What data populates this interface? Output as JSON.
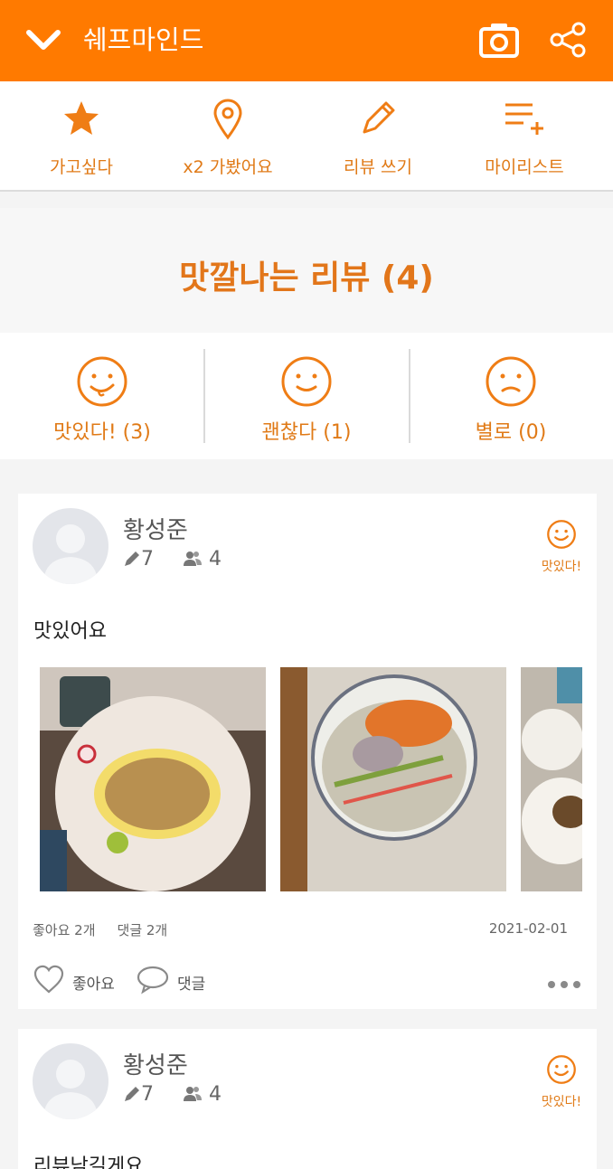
{
  "topbar": {
    "title": "쉐프마인드",
    "icons": [
      "chevron-down-icon",
      "camera-icon",
      "share-icon"
    ],
    "color": "#ff7a00"
  },
  "actions": [
    {
      "label": "가고싶다",
      "icon": "star-icon"
    },
    {
      "label": "x2 가봤어요",
      "icon": "location-pin-icon"
    },
    {
      "label": "리뷰 쓰기",
      "icon": "pencil-icon"
    },
    {
      "label": "마이리스트",
      "icon": "list-add-icon"
    }
  ],
  "reviews_header": "맛깔나는 리뷰 (4)",
  "ratings": [
    {
      "label": "맛있다! (3)",
      "icon": "tongue-smile-icon"
    },
    {
      "label": "괜찮다 (1)",
      "icon": "smile-icon"
    },
    {
      "label": "별로 (0)",
      "icon": "sad-icon"
    }
  ],
  "reviews": [
    {
      "user": "황성준",
      "review_count": "7",
      "follower_count": "4",
      "taste_label": "맛있다!",
      "text": "맛있어요",
      "likes_text": "좋아요 2개",
      "comments_text": "댓글 2개",
      "date": "2021-02-01",
      "like_button": "좋아요",
      "comment_button": "댓글"
    },
    {
      "user": "황성준",
      "review_count": "7",
      "follower_count": "4",
      "taste_label": "맛있다!",
      "text": "리뷰남길게요"
    }
  ],
  "colors": {
    "accent": "#ff7a00",
    "label": "#e07a17"
  }
}
